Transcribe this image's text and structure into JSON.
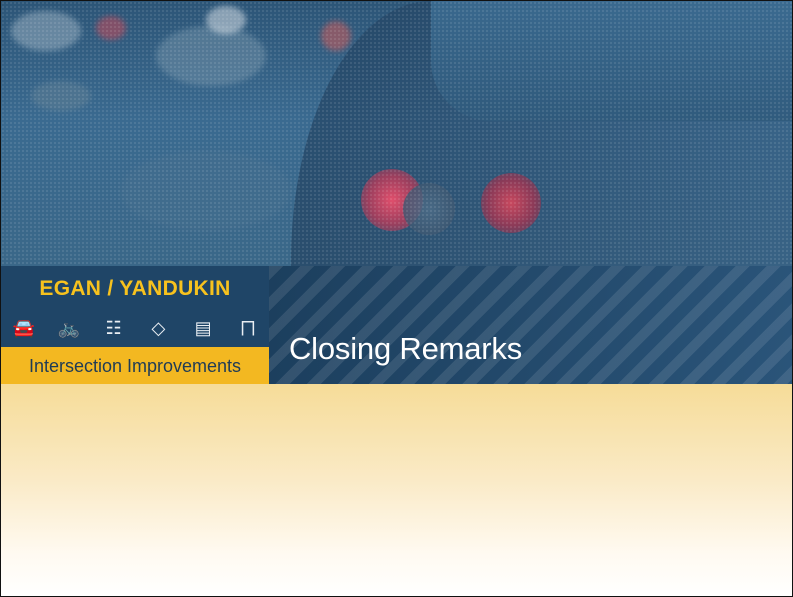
{
  "logo": {
    "title": "EGAN / YANDUKIN",
    "icons": [
      "car-icon",
      "bicycle-icon",
      "traffic-signal-icon",
      "pedestrian-crossing-icon",
      "bus-icon",
      "transit-shelter-icon"
    ],
    "subtitle": "Intersection Improvements"
  },
  "slide": {
    "title": "Closing Remarks"
  },
  "colors": {
    "navy": "#1f4567",
    "gold": "#f3b821",
    "title_text": "#ffffff"
  }
}
